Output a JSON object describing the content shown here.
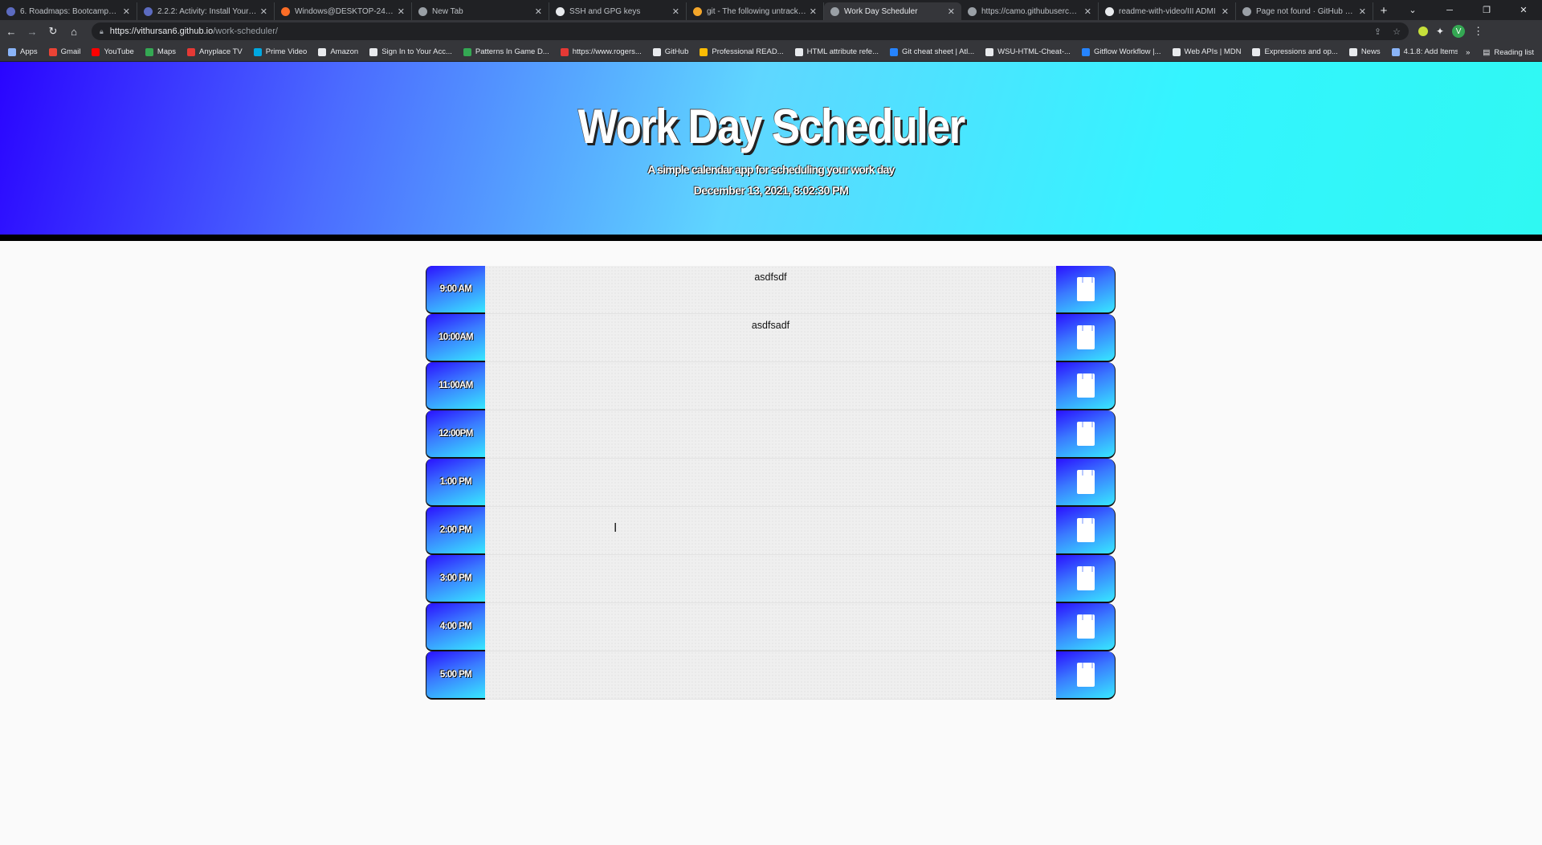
{
  "browser": {
    "tabs": [
      {
        "title": "6. Roadmaps: Bootcamps | HOK",
        "color": "#5c6bc0"
      },
      {
        "title": "2.2.2: Activity: Install Your Tool",
        "color": "#5c6bc0"
      },
      {
        "title": "Windows@DESKTOP-24KE14C",
        "color": "#fc6d26"
      },
      {
        "title": "New Tab",
        "color": "#9aa0a6"
      },
      {
        "title": "SSH and GPG keys",
        "color": "#e8eaed"
      },
      {
        "title": "git - The following untracked",
        "color": "#f4a62a"
      },
      {
        "title": "Work Day Scheduler",
        "color": "#9aa0a6"
      },
      {
        "title": "https://camo.githubusercontent",
        "color": "#9aa0a6"
      },
      {
        "title": "readme-with-video/III ADMI",
        "color": "#e8eaed"
      },
      {
        "title": "Page not found · GitHub Pages",
        "color": "#9aa0a6"
      }
    ],
    "active_tab_index": 6,
    "new_tab_label": "+",
    "url_host": "https://vithursan6.github.io",
    "url_path": "/work-scheduler/",
    "bookmarks": [
      {
        "label": "Apps",
        "color": "#8ab4f8"
      },
      {
        "label": "Gmail",
        "color": "#ea4335"
      },
      {
        "label": "YouTube",
        "color": "#ff0000"
      },
      {
        "label": "Maps",
        "color": "#34a853"
      },
      {
        "label": "Anyplace TV",
        "color": "#e53935"
      },
      {
        "label": "Prime Video",
        "color": "#00a8e1"
      },
      {
        "label": "Amazon",
        "color": "#e8eaed"
      },
      {
        "label": "Sign In to Your Acc...",
        "color": "#e8eaed"
      },
      {
        "label": "Patterns In Game D...",
        "color": "#34a853"
      },
      {
        "label": "https://www.rogers...",
        "color": "#e53935"
      },
      {
        "label": "GitHub",
        "color": "#e8eaed"
      },
      {
        "label": "Professional READ...",
        "color": "#fbbc04"
      },
      {
        "label": "HTML attribute refe...",
        "color": "#e8eaed"
      },
      {
        "label": "Git cheat sheet | Atl...",
        "color": "#2684ff"
      },
      {
        "label": "WSU-HTML-Cheat-...",
        "color": "#e8eaed"
      },
      {
        "label": "Gitflow Workflow |...",
        "color": "#2684ff"
      },
      {
        "label": "Web APIs | MDN",
        "color": "#e8eaed"
      },
      {
        "label": "Expressions and op...",
        "color": "#e8eaed"
      },
      {
        "label": "News",
        "color": "#e8eaed"
      },
      {
        "label": "4.1.8: Add Items wit...",
        "color": "#8ab4f8"
      }
    ],
    "bookmarks_overflow": "»",
    "reading_list": "Reading list",
    "profile_initial": "V"
  },
  "header": {
    "title": "Work Day Scheduler",
    "lead": "A simple calendar app for scheduling your work day",
    "current_date": "December 13, 2021, 8:02:30 PM"
  },
  "scheduler": {
    "rows": [
      {
        "hour": "9:00 AM",
        "note": "asdfsdf"
      },
      {
        "hour": "10:00AM",
        "note": "asdfsadf"
      },
      {
        "hour": "11:00AM",
        "note": ""
      },
      {
        "hour": "12:00PM",
        "note": ""
      },
      {
        "hour": "1:00 PM",
        "note": ""
      },
      {
        "hour": "2:00 PM",
        "note": ""
      },
      {
        "hour": "3:00 PM",
        "note": ""
      },
      {
        "hour": "4:00 PM",
        "note": ""
      },
      {
        "hour": "5:00 PM",
        "note": ""
      }
    ]
  },
  "colors": {
    "gradient_start": "#2a04ff",
    "gradient_end": "#2ff8f2",
    "row_bg": "#efefef"
  }
}
